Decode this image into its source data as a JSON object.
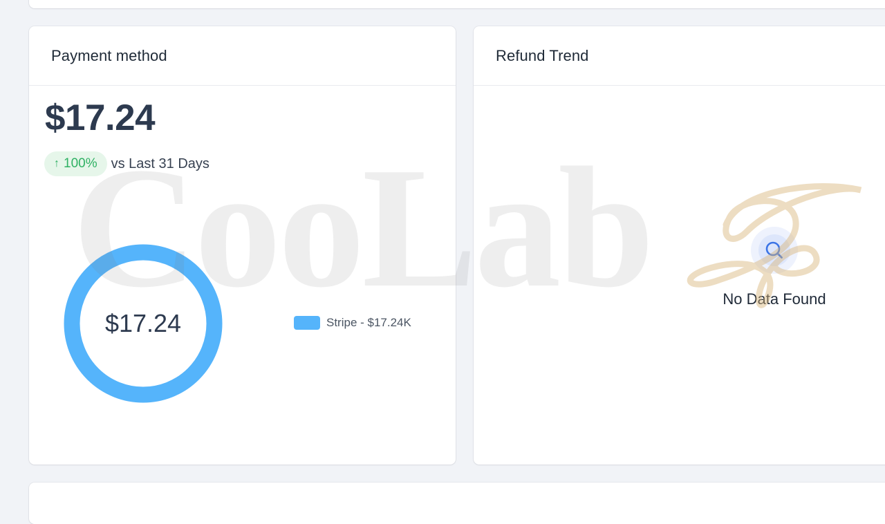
{
  "payment_card": {
    "title": "Payment method",
    "amount": "$17.24",
    "change_arrow": "↑",
    "change_percent": "100%",
    "change_label": "vs Last 31 Days",
    "donut_center": "$17.24",
    "legend": [
      {
        "label": "Stripe - $17.24K",
        "color": "#55b4fb",
        "share": 1.0
      }
    ]
  },
  "refund_card": {
    "title": "Refund Trend",
    "empty_icon": "search-icon",
    "empty_text": "No Data Found"
  },
  "watermark": {
    "text": "CooLab",
    "mark": "X"
  },
  "colors": {
    "accent": "#55b4fb",
    "positive": "#2fb163",
    "positive_bg": "#e6f6ea",
    "search_icon": "#3b74e6"
  }
}
